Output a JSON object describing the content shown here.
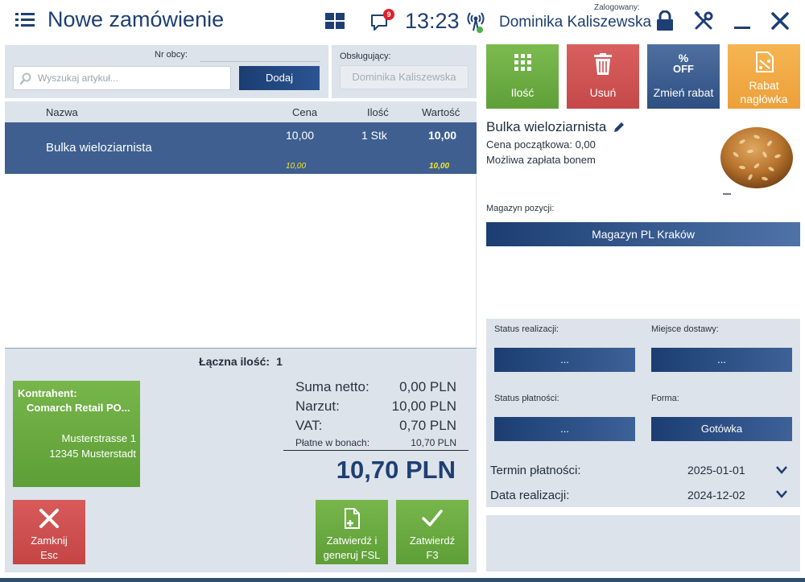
{
  "header": {
    "title": "Nowe zamówienie",
    "clock": "13:23",
    "notification_count": "9",
    "logged_label": "Zalogowany:",
    "user_name": "Dominika Kaliszewska"
  },
  "search": {
    "nr_obcy_label": "Nr obcy:",
    "placeholder": "Wyszukaj artykuł...",
    "add_label": "Dodaj"
  },
  "serving": {
    "label": "Obsługujący:",
    "value": "Dominika Kaliszewska"
  },
  "table": {
    "columns": [
      "Nazwa",
      "Cena",
      "Ilość",
      "Wartość"
    ],
    "rows": [
      {
        "name": "Bulka wieloziarnista",
        "price": "10,00",
        "qty": "1 Stk",
        "value": "10,00",
        "sub_price": "10,00",
        "sub_value": "10,00"
      }
    ]
  },
  "totals": {
    "qty_label": "Łączna ilość:",
    "qty_value": "1",
    "net_label": "Suma netto:",
    "net_value": "0,00 PLN",
    "markup_label": "Narzut:",
    "markup_value": "10,00 PLN",
    "vat_label": "VAT:",
    "vat_value": "0,70 PLN",
    "voucher_label": "Płatne w bonach:",
    "voucher_value": "10,70 PLN",
    "grand_total": "10,70 PLN"
  },
  "contractor": {
    "label": "Kontrahent:",
    "name": "Comarch Retail PO...",
    "address_line1": "Musterstrasse 1",
    "address_line2": "12345 Musterstadt"
  },
  "bottom_buttons": {
    "close_line1": "Zamknij",
    "close_line2": "Esc",
    "confirm_fsl_line1": "Zatwierdź i",
    "confirm_fsl_line2": "generuj FSL",
    "confirm_line1": "Zatwierdź",
    "confirm_line2": "F3"
  },
  "actions": {
    "qty": "Ilość",
    "delete": "Usuń",
    "discount": "Zmień rabat",
    "discount_icon_top": "%",
    "discount_icon_bottom": "OFF",
    "header_discount_line1": "Rabat",
    "header_discount_line2": "nagłówka"
  },
  "product": {
    "name": "Bulka wieloziarnista",
    "initial_price": "Cena początkowa: 0,00",
    "voucher_note": "Możliwa zapłata bonem",
    "warehouse_label": "Magazyn pozycji:",
    "warehouse_value": "Magazyn PL Kraków"
  },
  "details": {
    "status_realization_label": "Status realizacji:",
    "status_realization_value": "...",
    "delivery_place_label": "Miejsce dostawy:",
    "delivery_place_value": "...",
    "payment_status_label": "Status płatności:",
    "payment_status_value": "...",
    "form_label": "Forma:",
    "form_value": "Gotówka",
    "payment_due_label": "Termin płatności:",
    "payment_due_value": "2025-01-01",
    "realization_date_label": "Data realizacji:",
    "realization_date_value": "2024-12-02"
  },
  "colors": {
    "navy": "#1e3f73",
    "panel": "#dde3ea",
    "green": "#6aaa41",
    "red": "#cf5050",
    "orange": "#f1aa45",
    "selected_row": "#3e5f90",
    "highlight_yellow": "#f7e52b"
  }
}
